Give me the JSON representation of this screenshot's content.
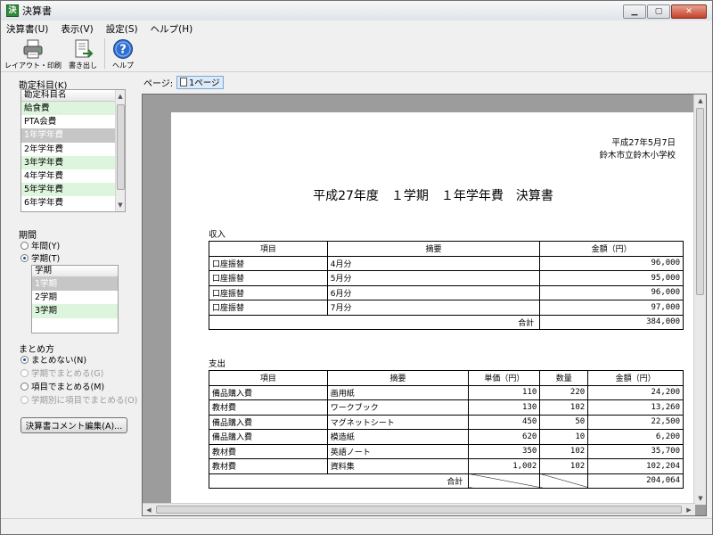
{
  "window": {
    "title": "決算書",
    "app_icon": "決"
  },
  "menubar": [
    "決算書(U)",
    "表示(V)",
    "設定(S)",
    "ヘルプ(H)"
  ],
  "toolbar": {
    "layout_print": "レイアウト・印刷",
    "export": "書き出し",
    "help": "ヘルプ"
  },
  "accounts": {
    "label": "勘定科目(K)",
    "header": "勘定科目名",
    "items": [
      "給食費",
      "PTA会費",
      "1年学年費",
      "2年学年費",
      "3年学年費",
      "4年学年費",
      "5年学年費",
      "6年学年費"
    ],
    "selected": "1年学年費"
  },
  "period": {
    "label": "期間",
    "options": [
      "年間(Y)",
      "学期(T)"
    ],
    "selected": "学期(T)",
    "list_header": "学期",
    "list_items": [
      "1学期",
      "2学期",
      "3学期"
    ],
    "list_selected": "1学期"
  },
  "grouping": {
    "label": "まとめ方",
    "options": [
      "まとめない(N)",
      "学期でまとめる(G)",
      "項目でまとめる(M)",
      "学期別に項目でまとめる(O)"
    ],
    "selected": "まとめない(N)",
    "disabled": [
      "学期でまとめる(G)",
      "学期別に項目でまとめる(O)"
    ]
  },
  "comment_button": "決算書コメント編集(A)...",
  "page_bar": {
    "label": "ページ:",
    "tab": "1ページ"
  },
  "document": {
    "date": "平成27年5月7日",
    "school": "鈴木市立鈴木小学校",
    "title": "平成27年度　１学期　１年学年費　決算書",
    "income": {
      "label": "収入",
      "headers": [
        "項目",
        "摘要",
        "金額（円）"
      ],
      "rows": [
        [
          "口座振替",
          "4月分",
          "96,000"
        ],
        [
          "口座振替",
          "5月分",
          "95,000"
        ],
        [
          "口座振替",
          "6月分",
          "96,000"
        ],
        [
          "口座振替",
          "7月分",
          "97,000"
        ]
      ],
      "total_label": "合計",
      "total": "384,000"
    },
    "expense": {
      "label": "支出",
      "headers": [
        "項目",
        "摘要",
        "単価（円）",
        "数量",
        "金額（円）"
      ],
      "rows": [
        [
          "備品購入費",
          "画用紙",
          "110",
          "220",
          "24,200"
        ],
        [
          "教材費",
          "ワークブック",
          "130",
          "102",
          "13,260"
        ],
        [
          "備品購入費",
          "マグネットシート",
          "450",
          "50",
          "22,500"
        ],
        [
          "備品購入費",
          "模造紙",
          "620",
          "10",
          "6,200"
        ],
        [
          "教材費",
          "英語ノート",
          "350",
          "102",
          "35,700"
        ],
        [
          "教材費",
          "資料集",
          "1,002",
          "102",
          "102,204"
        ]
      ],
      "total_label": "合計",
      "total": "204,064"
    }
  },
  "icons": {
    "app": "ledger-app-icon",
    "layout_print": "printer-icon",
    "export": "export-document-icon",
    "help": "help-question-icon",
    "page": "page-document-icon"
  },
  "colors": {
    "green_row": "#dcf5dc",
    "selected_row": "#c6c6c6",
    "preview_bg": "#9c9c9c",
    "help_blue": "#2f6fd0"
  }
}
